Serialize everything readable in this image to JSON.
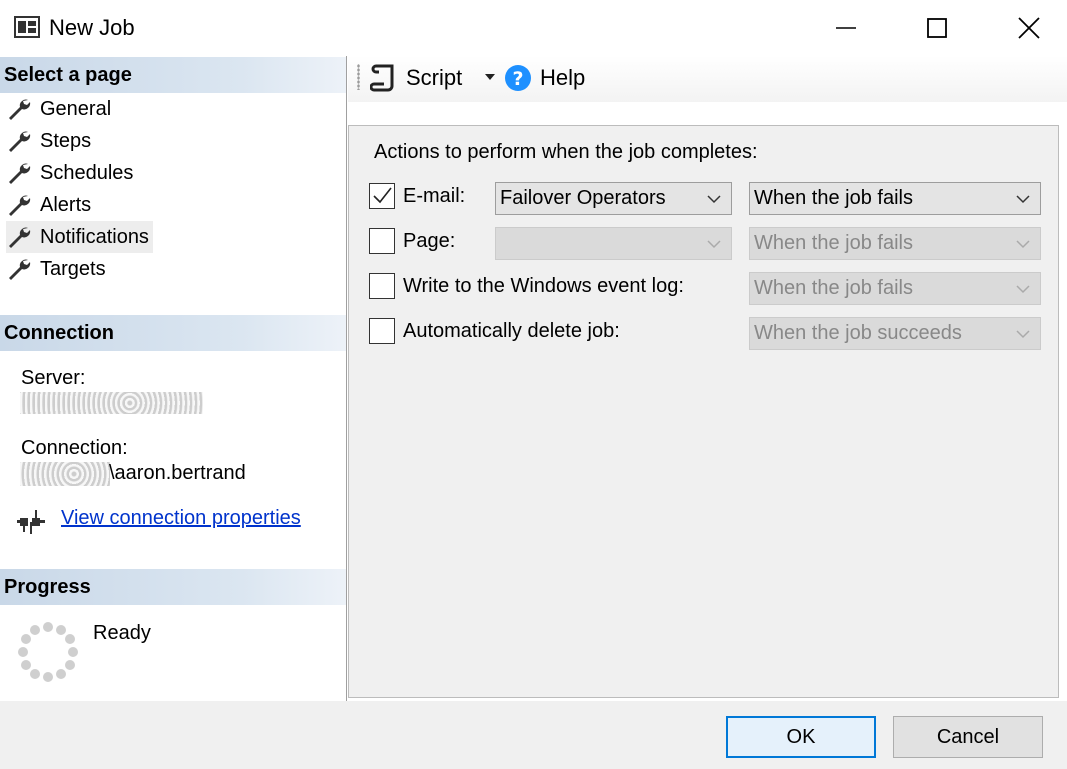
{
  "window": {
    "title": "New Job",
    "icon": "window-form-icon",
    "controls": [
      "minimize-icon",
      "maximize-icon",
      "close-icon"
    ]
  },
  "left_pane": {
    "select_page_header": "Select a page",
    "pages": [
      {
        "label": "General",
        "icon": "wrench-icon",
        "selected": false
      },
      {
        "label": "Steps",
        "icon": "wrench-icon",
        "selected": false
      },
      {
        "label": "Schedules",
        "icon": "wrench-icon",
        "selected": false
      },
      {
        "label": "Alerts",
        "icon": "wrench-icon",
        "selected": false
      },
      {
        "label": "Notifications",
        "icon": "wrench-icon",
        "selected": true
      },
      {
        "label": "Targets",
        "icon": "wrench-icon",
        "selected": false
      }
    ],
    "connection_header": "Connection",
    "server_label": "Server:",
    "connection_label": "Connection:",
    "connection_user_suffix": "\\aaron.bertrand",
    "view_connection_properties": "View connection properties",
    "progress_header": "Progress",
    "progress_status": "Ready"
  },
  "toolbar": {
    "script_label": "Script",
    "help_label": "Help"
  },
  "main": {
    "heading": "Actions to perform when the job completes:",
    "rows": [
      {
        "label": "E-mail:",
        "checked": true,
        "operator_value": "Failover Operators",
        "operator_enabled": true,
        "condition": "When the job fails",
        "condition_enabled": true
      },
      {
        "label": "Page:",
        "checked": false,
        "operator_value": "",
        "operator_enabled": false,
        "condition": "When the job fails",
        "condition_enabled": false
      },
      {
        "label": "Write to the Windows event log:",
        "checked": false,
        "condition": "When the job fails",
        "condition_enabled": false
      },
      {
        "label": "Automatically delete job:",
        "checked": false,
        "condition": "When the job succeeds",
        "condition_enabled": false
      }
    ]
  },
  "buttons": {
    "ok": "OK",
    "cancel": "Cancel"
  },
  "colors": {
    "section_header": "#c9d8e8",
    "link": "#0033cc",
    "help_icon": "#1e90ff",
    "ok_border": "#0078d7"
  }
}
